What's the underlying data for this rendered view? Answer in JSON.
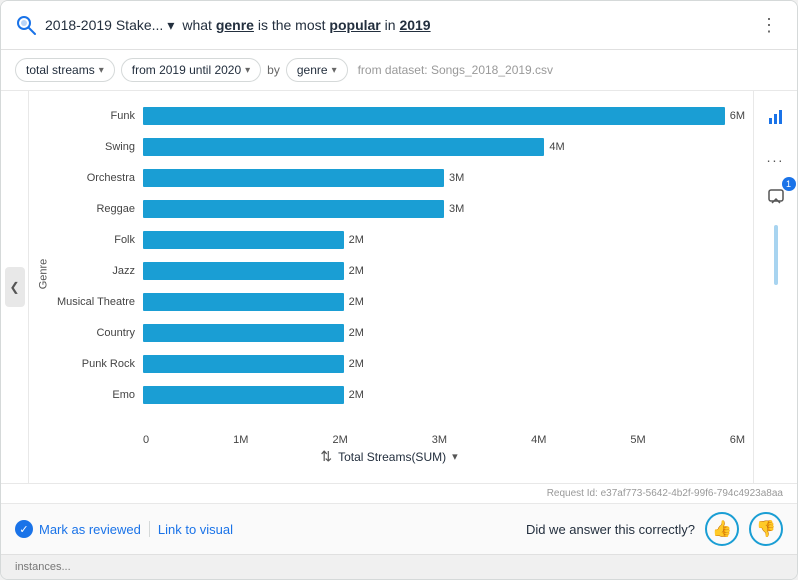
{
  "header": {
    "search_icon": "search",
    "title": "2018-2019 Stake...",
    "title_dropdown": "▾",
    "question_prefix": "what",
    "genre_highlight": "genre",
    "question_middle": "is the most",
    "popular_highlight": "popular",
    "question_suffix": "in",
    "year_highlight": "2019",
    "more_icon": "⋮"
  },
  "filters": {
    "total_streams": "total streams",
    "date_range": "from 2019 until 2020",
    "by_label": "by",
    "genre": "genre",
    "dataset": "from dataset: Songs_2018_2019.csv"
  },
  "chart": {
    "y_axis_label": "Genre",
    "x_axis_sort_label": "Total Streams(SUM)",
    "x_axis_labels": [
      "0",
      "1M",
      "2M",
      "3M",
      "4M",
      "5M",
      "6M"
    ],
    "max_value": 6000000,
    "bars": [
      {
        "label": "Funk",
        "value": 6000000,
        "display": "6M"
      },
      {
        "label": "Swing",
        "value": 4000000,
        "display": "4M"
      },
      {
        "label": "Orchestra",
        "value": 3000000,
        "display": "3M"
      },
      {
        "label": "Reggae",
        "value": 3000000,
        "display": "3M"
      },
      {
        "label": "Folk",
        "value": 2000000,
        "display": "2M"
      },
      {
        "label": "Jazz",
        "value": 2000000,
        "display": "2M"
      },
      {
        "label": "Musical Theatre",
        "value": 2000000,
        "display": "2M"
      },
      {
        "label": "Country",
        "value": 2000000,
        "display": "2M"
      },
      {
        "label": "Punk Rock",
        "value": 2000000,
        "display": "2M"
      },
      {
        "label": "Emo",
        "value": 2000000,
        "display": "2M"
      }
    ]
  },
  "request_id": "Request Id: e37af773-5642-4b2f-99f6-794c4923a8aa",
  "footer": {
    "mark_reviewed": "Mark as reviewed",
    "link_visual": "Link to visual",
    "feedback_question": "Did we answer this correctly?",
    "thumbs_up": "👍",
    "thumbs_down": "👎"
  },
  "bottom_strip": "instances...",
  "sidebar_icons": {
    "chart_icon": "chart",
    "more_icon": "...",
    "comment_icon": "comment",
    "notification_count": "1"
  }
}
